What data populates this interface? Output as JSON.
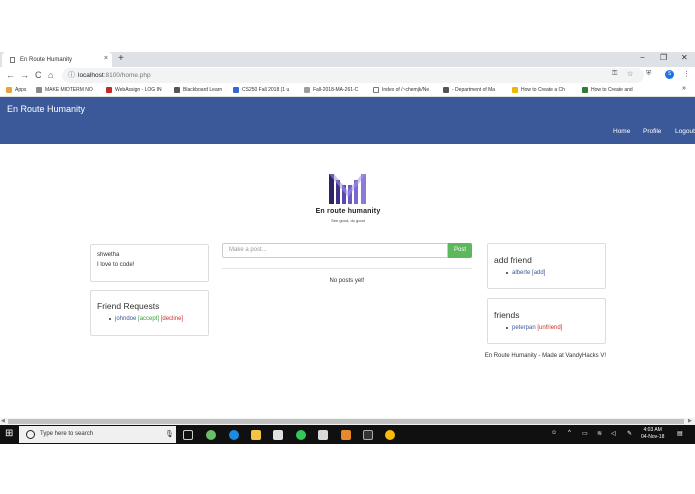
{
  "browser": {
    "tab_title": "En Route Humanity",
    "tab_close": "×",
    "new_tab": "+",
    "window_controls": [
      "−",
      "❐",
      "✕"
    ],
    "nav": {
      "back": "←",
      "forward": "→",
      "reload": "C",
      "home": "⌂"
    },
    "url_host": "localhost",
    "url_path": ":8100/home.php",
    "avatar_letter": "S",
    "menu": "⋮",
    "bookmarks": [
      {
        "label": "Apps",
        "color": "#e8a33d"
      },
      {
        "label": "MAKE MIDTERM NO",
        "color": "#8a8a8a"
      },
      {
        "label": "WebAssign - LOG IN",
        "color": "#c62828"
      },
      {
        "label": "Blackboard Learn",
        "color": "#555555"
      },
      {
        "label": "CS250 Fall 2018 (1 u",
        "color": "#3367d6"
      },
      {
        "label": "Fall-2018-MA-261-C",
        "color": "#9e9e9e"
      },
      {
        "label": "Index of /~chemjk/Ne",
        "color": "#ffffff"
      },
      {
        "label": "- Department of Ma",
        "color": "#555555"
      },
      {
        "label": "How to Create a Ch",
        "color": "#f4b400"
      },
      {
        "label": "How to Create and",
        "color": "#2e7d32"
      }
    ],
    "bookmarks_more": "»"
  },
  "site": {
    "brand": "En Route Humanity",
    "nav_links": [
      "Home",
      "Profile",
      "Logout"
    ],
    "logo_title": "En route humanity",
    "logo_subtitle": "See good, do good",
    "profile": {
      "name": "shwetha",
      "bio": "I love to code!"
    },
    "friend_requests": {
      "heading": "Friend Requests",
      "items": [
        {
          "user": "johndoe",
          "accept": "[accept]",
          "decline": "[decline]"
        }
      ]
    },
    "post": {
      "placeholder": "Make a post...",
      "button": "Post",
      "empty": "No posts yet!"
    },
    "add_friend": {
      "heading": "add friend",
      "items": [
        {
          "user": "alberte",
          "action": "[add]"
        }
      ]
    },
    "friends": {
      "heading": "friends",
      "items": [
        {
          "user": "peterpan",
          "action": "[unfriend]"
        }
      ]
    },
    "footer": "En Route Humanity - Made at VandyHacks V!"
  },
  "taskbar": {
    "search_placeholder": "Type here to search",
    "time": "4:03 AM",
    "date": "04-Nov-18"
  }
}
